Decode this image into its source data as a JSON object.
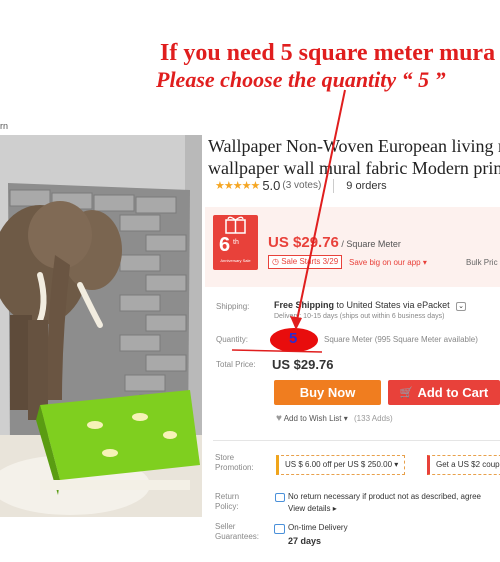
{
  "annotation": {
    "line1": "If you need  5  square meter mura",
    "line2": "Please choose the quantity “ 5 ”"
  },
  "breadcrumb": "rn",
  "product": {
    "title_line1": "Wallpaper Non-Woven European living ro",
    "title_line2": "wallpaper wall mural fabric Modern printed",
    "rating": "5.0",
    "votes": "(3 votes)",
    "orders": "9 orders"
  },
  "price": {
    "badge_big": "6",
    "badge_th": "th",
    "badge_sub": "Anniversary Sale",
    "amount": "US $29.76",
    "unit": " / Square Meter",
    "sale_label": "Sale Starts 3/29",
    "app_promo": "Save big on our app ▾",
    "bulk_label": "Bulk Pric"
  },
  "shipping": {
    "label": "Shipping:",
    "free": "Free Shipping",
    "dest": " to  United States via ePacket",
    "delivery": "Delivery: 10-15 days (ships out within 6 business days)"
  },
  "quantity": {
    "label": "Quantity:",
    "value": "5",
    "unit_info": "Square Meter (995 Square Meter available)"
  },
  "total": {
    "label": "Total Price:",
    "value": "US $29.76"
  },
  "actions": {
    "buy_now": "Buy Now",
    "add_to_cart": "Add to Cart",
    "wish": "Add to Wish List ▾",
    "wish_count": "(133 Adds)"
  },
  "store_promotion": {
    "label_1": "Store",
    "label_2": "Promotion:",
    "coupon1": "US $ 6.00 off per US $ 250.00 ▾",
    "coupon2": "Get a US $2 coup"
  },
  "return_policy": {
    "label_1": "Return",
    "label_2": "Policy:",
    "text": "No return necessary if product not as described, agree",
    "details": "View details ▸"
  },
  "seller_guarantees": {
    "label_1": "Seller",
    "label_2": "Guarantees:",
    "text": "On-time Delivery",
    "days": "27 days"
  },
  "colors": {
    "accent_red": "#e8413a",
    "buy_orange": "#f07d1f",
    "annotation_red": "#e01e1e",
    "star": "#f5a623"
  },
  "icons": [
    "star-icon",
    "gift-badge-icon",
    "clock-icon",
    "dropdown-icon",
    "cart-icon",
    "heart-icon",
    "return-icon",
    "delivery-icon"
  ]
}
